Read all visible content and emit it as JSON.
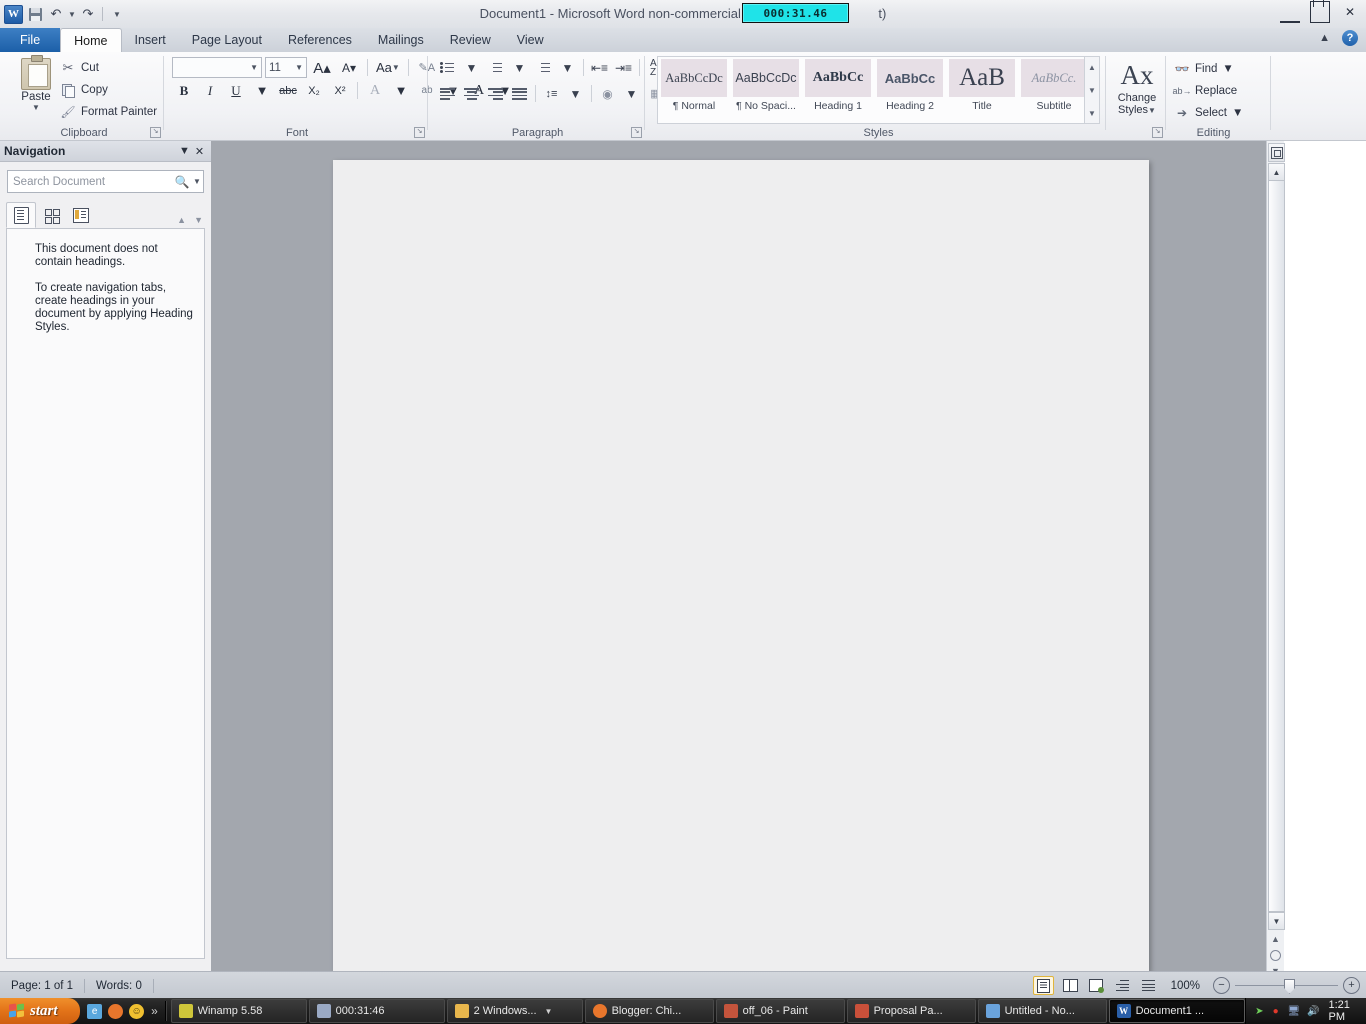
{
  "titlebar": {
    "document_title": "Document1  -  Microsoft Word non-commercial use (",
    "document_title_tail": "t)",
    "timer_value": "000:31.46",
    "quick_access": {
      "save": "Save",
      "undo": "Undo",
      "redo": "Redo",
      "customize": "Customize Quick Access Toolbar"
    },
    "window": {
      "minimize": "Minimize",
      "restore": "Restore Down",
      "close": "Close"
    }
  },
  "ribbon": {
    "tabs": [
      {
        "label": "File",
        "active": false
      },
      {
        "label": "Home",
        "active": true
      },
      {
        "label": "Insert",
        "active": false
      },
      {
        "label": "Page Layout",
        "active": false
      },
      {
        "label": "References",
        "active": false
      },
      {
        "label": "Mailings",
        "active": false
      },
      {
        "label": "Review",
        "active": false
      },
      {
        "label": "View",
        "active": false
      }
    ],
    "collapse_label": "Minimize the Ribbon",
    "help_label": "?",
    "clipboard": {
      "group_label": "Clipboard",
      "paste_label": "Paste",
      "cut_label": "Cut",
      "copy_label": "Copy",
      "format_painter_label": "Format Painter"
    },
    "font": {
      "group_label": "Font",
      "font_name_value": "",
      "font_name_placeholder": "",
      "font_size_value": "11",
      "grow_font": "A",
      "shrink_font": "A",
      "change_case": "Aa",
      "clear_formatting": "clear-formatting",
      "bold": "B",
      "italic": "I",
      "underline": "U",
      "strikethrough": "abc",
      "subscript": "X₂",
      "superscript": "X²",
      "text_effects": "A",
      "highlight": "ab",
      "font_color": "A"
    },
    "paragraph": {
      "group_label": "Paragraph",
      "bullets": "bullets",
      "numbering": "numbering",
      "multilevel": "multilevel-list",
      "decrease_indent": "decrease-indent",
      "increase_indent": "increase-indent",
      "sort": "A\nZ",
      "show_marks": "¶",
      "align_left": "align-left",
      "align_center": "align-center",
      "align_right": "align-right",
      "justify": "justify",
      "line_spacing": "line-spacing",
      "shading": "shading",
      "borders": "borders"
    },
    "styles": {
      "group_label": "Styles",
      "items": [
        {
          "preview": "AaBbCcDc",
          "name": "¶ Normal"
        },
        {
          "preview": "AaBbCcDc",
          "name": "¶ No Spaci..."
        },
        {
          "preview": "AaBbCс",
          "name": "Heading 1"
        },
        {
          "preview": "AaBbCc",
          "name": "Heading 2"
        },
        {
          "preview": "AaB",
          "name": "Title"
        },
        {
          "preview": "AaBbCc.",
          "name": "Subtitle"
        }
      ],
      "change_styles_label": "Change\nStyles",
      "change_styles_line1": "Change",
      "change_styles_line2": "Styles"
    },
    "editing": {
      "group_label": "Editing",
      "find_label": "Find",
      "replace_label": "Replace",
      "select_label": "Select"
    }
  },
  "navigation": {
    "title": "Navigation",
    "search_placeholder": "Search Document",
    "search_value": "",
    "tabs": [
      {
        "name": "browse-headings",
        "active": true
      },
      {
        "name": "browse-pages",
        "active": false
      },
      {
        "name": "browse-results",
        "active": false
      }
    ],
    "message_1": "This document does not contain headings.",
    "message_2": "To create navigation tabs, create headings in your document by applying Heading Styles."
  },
  "statusbar": {
    "page_label": "Page: 1 of 1",
    "words_label": "Words: 0",
    "zoom_level": "100%",
    "views": [
      {
        "name": "print-layout",
        "active": true
      },
      {
        "name": "full-screen-reading",
        "active": false
      },
      {
        "name": "web-layout",
        "active": false
      },
      {
        "name": "outline",
        "active": false
      },
      {
        "name": "draft",
        "active": false
      }
    ],
    "zoom_out": "−",
    "zoom_in": "+"
  },
  "taskbar": {
    "start_label": "start",
    "quick_launch_more": "»",
    "items": [
      {
        "label": "Winamp 5.58",
        "active": false,
        "has_chevron": false,
        "icon": "winamp-icon",
        "color": "#d6cf3f"
      },
      {
        "label": "000:31:46",
        "active": false,
        "has_chevron": false,
        "icon": "timer-icon",
        "color": "#9aa9c4"
      },
      {
        "label": "2 Windows...",
        "active": false,
        "has_chevron": true,
        "icon": "folder-icon",
        "color": "#e8b64c"
      },
      {
        "label": "Blogger: Chi...",
        "active": false,
        "has_chevron": false,
        "icon": "firefox-icon",
        "color": "#e8762c"
      },
      {
        "label": "off_06 - Paint",
        "active": false,
        "has_chevron": false,
        "icon": "paint-icon",
        "color": "#c4543c"
      },
      {
        "label": "Proposal Pa...",
        "active": false,
        "has_chevron": false,
        "icon": "document-icon",
        "color": "#c9503a"
      },
      {
        "label": "Untitled - No...",
        "active": false,
        "has_chevron": false,
        "icon": "notepad-icon",
        "color": "#6aa3dc"
      },
      {
        "label": "Document1 ...",
        "active": true,
        "has_chevron": false,
        "icon": "word-icon",
        "color": "#2a5fa8"
      }
    ],
    "tray_icons": [
      "safely-remove-hardware-icon",
      "record-icon",
      "network-icon",
      "volume-icon"
    ],
    "clock": "1:21 PM"
  }
}
